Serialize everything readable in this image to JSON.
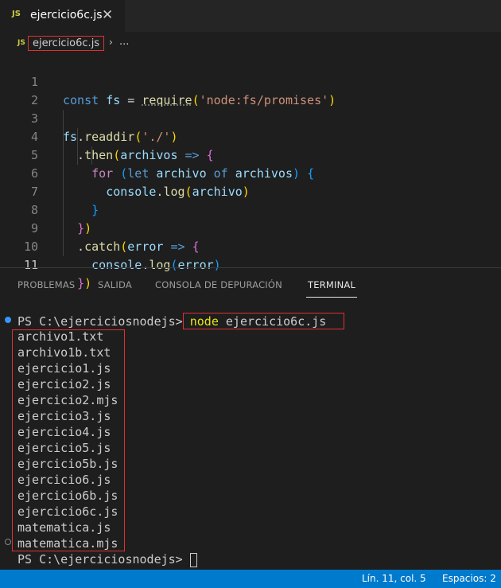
{
  "tab": {
    "icon": "JS",
    "filename": "ejercicio6c.js",
    "close_glyph": "✕"
  },
  "breadcrumb": {
    "icon": "JS",
    "file": "ejercicio6c.js",
    "separator": "›",
    "more": "..."
  },
  "editor": {
    "line_numbers": [
      "1",
      "2",
      "3",
      "4",
      "5",
      "6",
      "7",
      "8",
      "9",
      "10",
      "11"
    ],
    "lines": [
      "const fs = require('node:fs/promises')",
      "",
      "fs.readdir('./')",
      "  .then(archivos => {",
      "    for (let archivo of archivos) {",
      "      console.log(archivo)",
      "    }",
      "  })",
      "  .catch(error => {",
      "    console.log(error)",
      "  })"
    ],
    "active_line": "11"
  },
  "panel": {
    "tabs": [
      "PROBLEMAS",
      "SALIDA",
      "CONSOLA DE DEPURACIÓN",
      "TERMINAL"
    ],
    "active_tab": "TERMINAL"
  },
  "terminal": {
    "prompt": "PS C:\\ejerciciosnodejs>",
    "command": "node ejercicio6c.js",
    "command_program": "node",
    "command_args": " ejercicio6c.js",
    "output": [
      "archivo1.txt",
      "archivo1b.txt",
      "ejercicio1.js",
      "ejercicio2.js",
      "ejercicio2.mjs",
      "ejercicio3.js",
      "ejercicio4.js",
      "ejercicio5.js",
      "ejercicio5b.js",
      "ejercicio6.js",
      "ejercicio6b.js",
      "ejercicio6c.js",
      "matematica.js",
      "matematica.mjs"
    ],
    "final_prompt": "PS C:\\ejerciciosnodejs>"
  },
  "statusbar": {
    "position": "Lín. 11, col. 5",
    "spaces": "Espacios: 2"
  },
  "colors": {
    "accent": "#007acc",
    "highlight_box": "#e03131",
    "js_icon": "#cbcb41"
  }
}
